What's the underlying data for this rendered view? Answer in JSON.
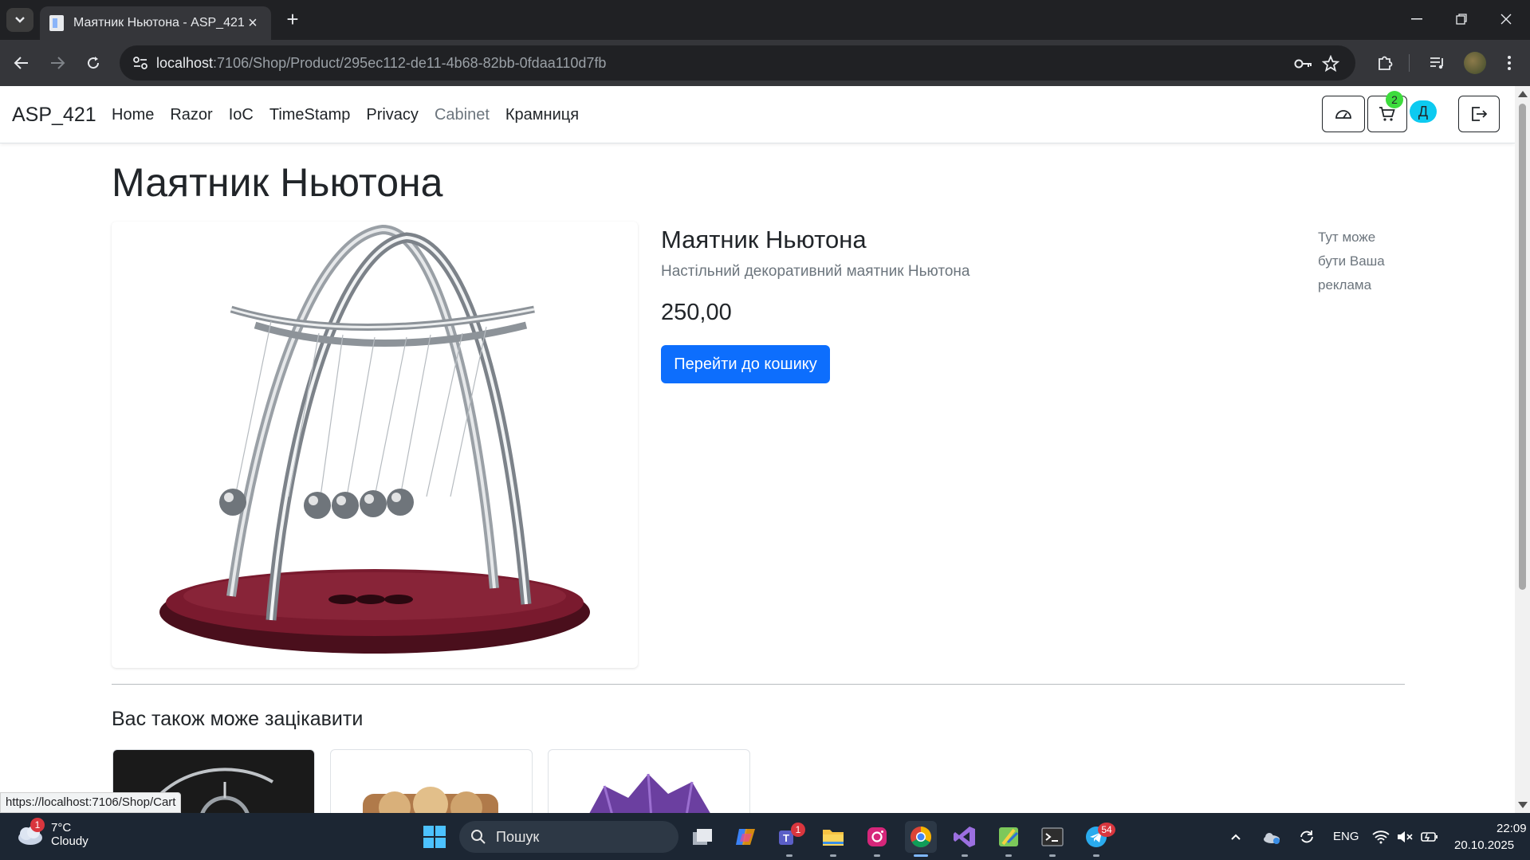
{
  "browser": {
    "tab_title": "Маятник Ньютона - ASP_421",
    "url_host": "localhost",
    "url_path": ":7106/Shop/Product/295ec112-de11-4b68-82bb-0fdaa110d7fb"
  },
  "site": {
    "brand": "ASP_421",
    "nav": [
      "Home",
      "Razor",
      "IoC",
      "TimeStamp",
      "Privacy",
      "Cabinet",
      "Крамниця"
    ],
    "cart_count": "2",
    "user_initial": "Д"
  },
  "page": {
    "heading": "Маятник Ньютона",
    "product_title": "Маятник Ньютона",
    "product_description": "Настільний декоративний маятник Ньютона",
    "price": "250,00",
    "cart_button": "Перейти до кошику",
    "ad_text": "Тут може бути Ваша реклама",
    "related_heading": "Вас також може зацікавити"
  },
  "status_url": "https://localhost:7106/Shop/Cart",
  "taskbar": {
    "weather_temp": "7°C",
    "weather_desc": "Cloudy",
    "weather_badge": "1",
    "search_label": "Пошук",
    "teams_badge": "1",
    "telegram_badge": "54",
    "lang": "ENG",
    "time": "22:09",
    "date": "20.10.2025"
  }
}
